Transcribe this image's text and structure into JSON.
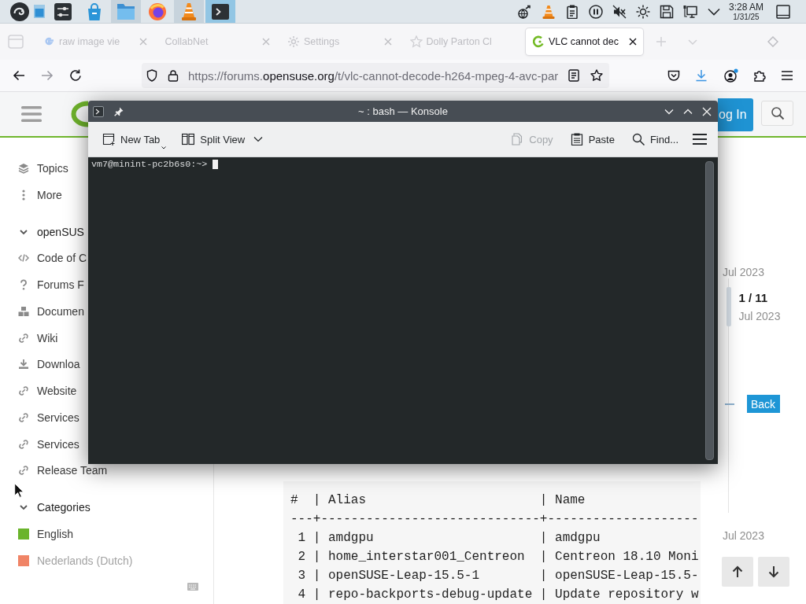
{
  "taskbar": {
    "tasks": [
      {
        "kind": "sliders",
        "running": false,
        "selected": false
      },
      {
        "kind": "bag",
        "running": false,
        "selected": false
      },
      {
        "kind": "folder",
        "running": true,
        "selected": false
      },
      {
        "kind": "browser",
        "running": false,
        "selected": false
      },
      {
        "kind": "cone",
        "running": true,
        "selected": false
      },
      {
        "kind": "terminal",
        "running": true,
        "selected": true
      }
    ],
    "clock": {
      "time": "3:28 AM",
      "date": "1/31/25"
    }
  },
  "browser": {
    "tabs": [
      {
        "kind": "letter",
        "title": "raw image vie",
        "selected": false,
        "closable": true
      },
      {
        "kind": "none",
        "title": "CollabNet",
        "selected": false,
        "closable": true
      },
      {
        "kind": "gear",
        "title": "Settings",
        "selected": false,
        "closable": true
      },
      {
        "kind": "star",
        "title": "Dolly Parton Cl",
        "selected": false,
        "closable": false
      },
      {
        "kind": "leaf",
        "title": "VLC cannot dec",
        "selected": true,
        "closable": true
      }
    ],
    "url": {
      "scheme": "https://forums.",
      "domain": "opensuse.org",
      "path": "/t/vlc-cannot-decode-h264-mpeg-4-avc-par"
    }
  },
  "page": {
    "login_label": "og In",
    "sidebar": {
      "items": [
        {
          "kind": "layers",
          "label": "Topics"
        },
        {
          "kind": "dots",
          "label": "More"
        }
      ],
      "sections": [
        {
          "title": "openSUS",
          "expanded": true,
          "links": [
            {
              "kind": "code",
              "label": "Code of C"
            },
            {
              "kind": "question",
              "label": "Forums F"
            },
            {
              "kind": "cubes",
              "label": "Documen"
            },
            {
              "kind": "link",
              "label": "Wiki"
            },
            {
              "kind": "download",
              "label": "Downloa"
            },
            {
              "kind": "link",
              "label": "Website"
            },
            {
              "kind": "link",
              "label": "Services"
            },
            {
              "kind": "link",
              "label": "Services"
            },
            {
              "kind": "link",
              "label": "Release Team"
            }
          ]
        },
        {
          "title": "Categories",
          "expanded": true,
          "links": [
            {
              "kind": "swatch",
              "label": "English",
              "color": "#6ab42c"
            },
            {
              "kind": "swatch",
              "label": "Nederlands (Dutch)",
              "color": "#f08466"
            }
          ]
        }
      ]
    },
    "code_block": {
      "lines": [
        "#  | Alias                       | Name",
        "---+-----------------------------+--------------------",
        " 1 | amdgpu                      | amdgpu",
        " 2 | home_interstar001_Centreon  | Centreon 18.10 Moni",
        " 3 | openSUSE-Leap-15.5-1        | openSUSE-Leap-15.5-",
        " 4 | repo-backports-debug-update | Update repository w"
      ]
    },
    "timeline": {
      "top_date": "Jul 2023",
      "position": "1 / 11",
      "position_date": "Jul 2023",
      "back_label": "Back",
      "bottom_date": "Jul 2023"
    }
  },
  "konsole": {
    "title": "~ : bash — Konsole",
    "toolbar": [
      {
        "kind": "new-tab",
        "label": "New Tab",
        "disabled": false
      },
      {
        "kind": "split",
        "label": "Split View",
        "disabled": false
      },
      {
        "kind": "copy",
        "label": "Copy",
        "disabled": true
      },
      {
        "kind": "paste",
        "label": "Paste",
        "disabled": false
      },
      {
        "kind": "find",
        "label": "Find...",
        "disabled": false
      }
    ],
    "prompt": "vm7@minint-pc2b6s0:~>"
  }
}
